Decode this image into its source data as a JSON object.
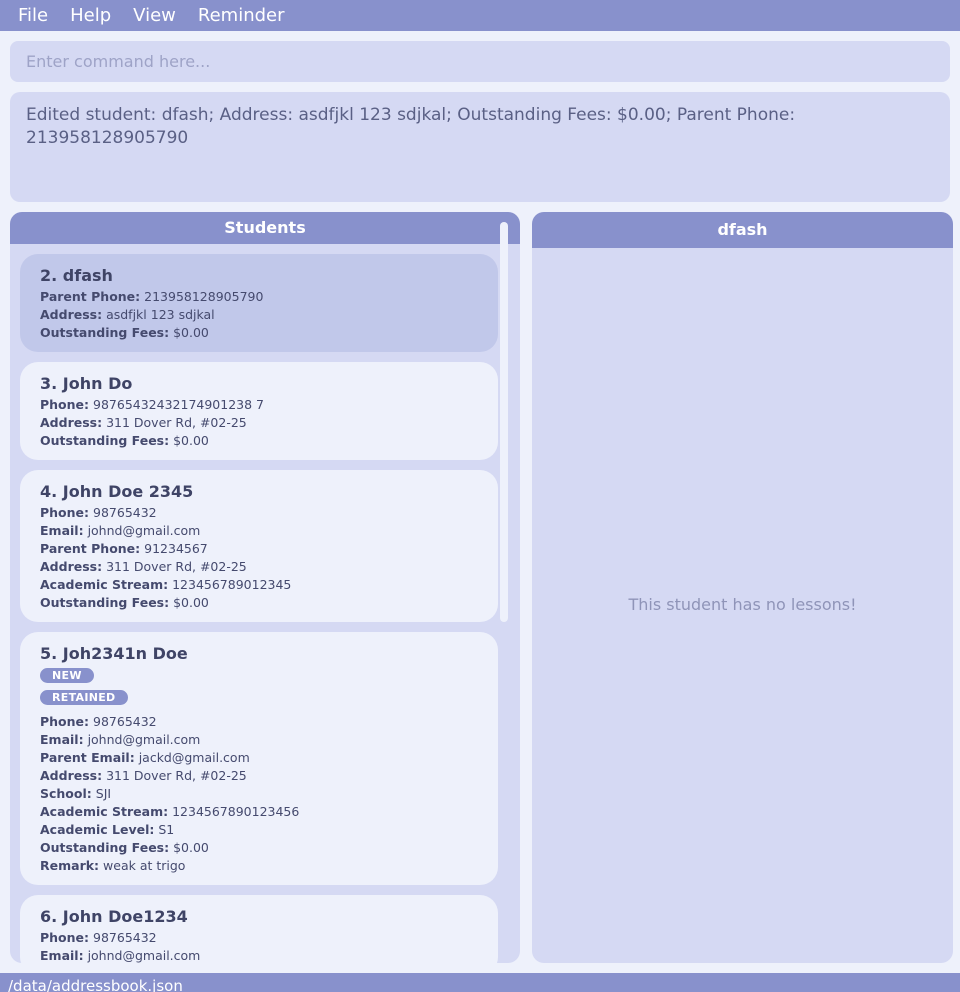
{
  "menu": [
    "File",
    "Help",
    "View",
    "Reminder"
  ],
  "command": {
    "placeholder": "Enter command here...",
    "value": ""
  },
  "result": "Edited student: dfash; Address: asdfjkl 123 sdjkal; Outstanding Fees: $0.00; Parent Phone: 213958128905790",
  "students_panel": {
    "title": "Students",
    "cards": [
      {
        "title": "2.  dfash",
        "selected": true,
        "tags": [],
        "fields": [
          {
            "label": "Parent Phone:",
            "value": "213958128905790"
          },
          {
            "label": "Address:",
            "value": "asdfjkl 123 sdjkal"
          },
          {
            "label": "Outstanding Fees:",
            "value": "$0.00"
          }
        ]
      },
      {
        "title": "3.  John Do",
        "selected": false,
        "tags": [],
        "fields": [
          {
            "label": "Phone:",
            "value": "98765432432174901238 7"
          },
          {
            "label": "Address:",
            "value": "311 Dover Rd, #02-25"
          },
          {
            "label": "Outstanding Fees:",
            "value": "$0.00"
          }
        ]
      },
      {
        "title": "4.  John Doe 2345",
        "selected": false,
        "tags": [],
        "fields": [
          {
            "label": "Phone:",
            "value": "98765432"
          },
          {
            "label": "Email:",
            "value": "johnd@gmail.com"
          },
          {
            "label": "Parent Phone:",
            "value": "91234567"
          },
          {
            "label": "Address:",
            "value": "311 Dover Rd, #02-25"
          },
          {
            "label": "Academic Stream:",
            "value": "123456789012345"
          },
          {
            "label": "Outstanding Fees:",
            "value": "$0.00"
          }
        ]
      },
      {
        "title": "5.  Joh2341n Doe",
        "selected": false,
        "tags": [
          "NEW",
          "RETAINED"
        ],
        "fields": [
          {
            "label": "Phone:",
            "value": "98765432"
          },
          {
            "label": "Email:",
            "value": "johnd@gmail.com"
          },
          {
            "label": "Parent Email:",
            "value": "jackd@gmail.com"
          },
          {
            "label": "Address:",
            "value": "311 Dover Rd, #02-25"
          },
          {
            "label": "School:",
            "value": "SJI"
          },
          {
            "label": "Academic Stream:",
            "value": "1234567890123456"
          },
          {
            "label": "Academic Level:",
            "value": "S1"
          },
          {
            "label": "Outstanding Fees:",
            "value": "$0.00"
          },
          {
            "label": "Remark:",
            "value": "weak at trigo"
          }
        ]
      },
      {
        "title": "6.  John Doe1234",
        "selected": false,
        "tags": [],
        "fields": [
          {
            "label": "Phone:",
            "value": "98765432"
          },
          {
            "label": "Email:",
            "value": "johnd@gmail.com"
          }
        ]
      }
    ]
  },
  "detail_panel": {
    "title": "dfash",
    "empty_message": "This student has no lessons!"
  },
  "status": "/data/addressbook.json"
}
